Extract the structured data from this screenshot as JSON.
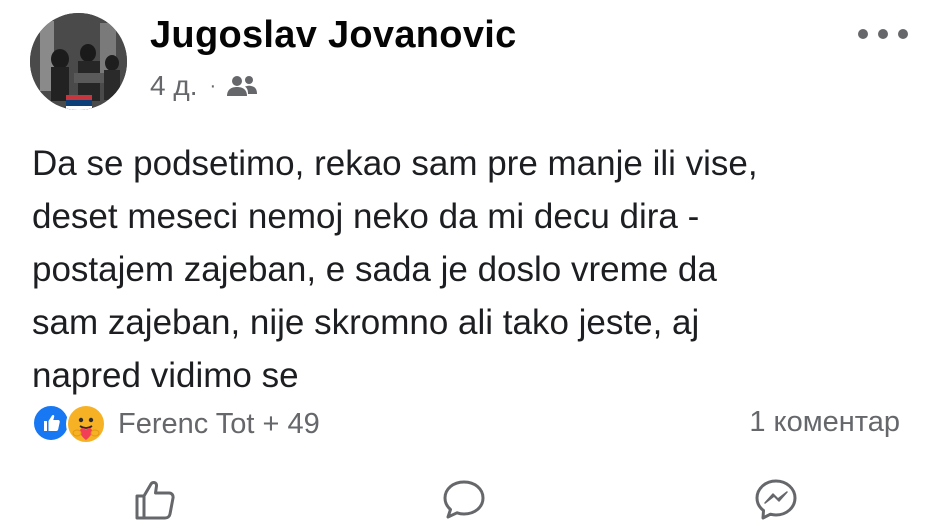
{
  "post": {
    "author": "Jugoslav Jovanovic",
    "time": "4 д.",
    "separator": "·",
    "audience_icon": "friends-icon",
    "more_icon": "more-options-icon",
    "text": "Da se podsetimo, rekao sam pre manje ili vise,\ndeset meseci nemoj neko da mi decu dira -\npostajem zajeban, e sada je doslo vreme da\nsam zajeban, nije skromno ali tako jeste, aj\nnapred vidimo se"
  },
  "reactions": {
    "icons": [
      "like-icon",
      "care-icon"
    ],
    "summary": "Ferenc Tot + 49",
    "comments": "1 коментар"
  },
  "actions": [
    "like-icon",
    "comment-icon",
    "messenger-icon"
  ],
  "colors": {
    "like_blue": "#1877f2",
    "care_yellow": "#f7b125",
    "secondary_text": "#65676b",
    "flag": [
      "#c6363c",
      "#0c4076",
      "#ffffff"
    ]
  }
}
